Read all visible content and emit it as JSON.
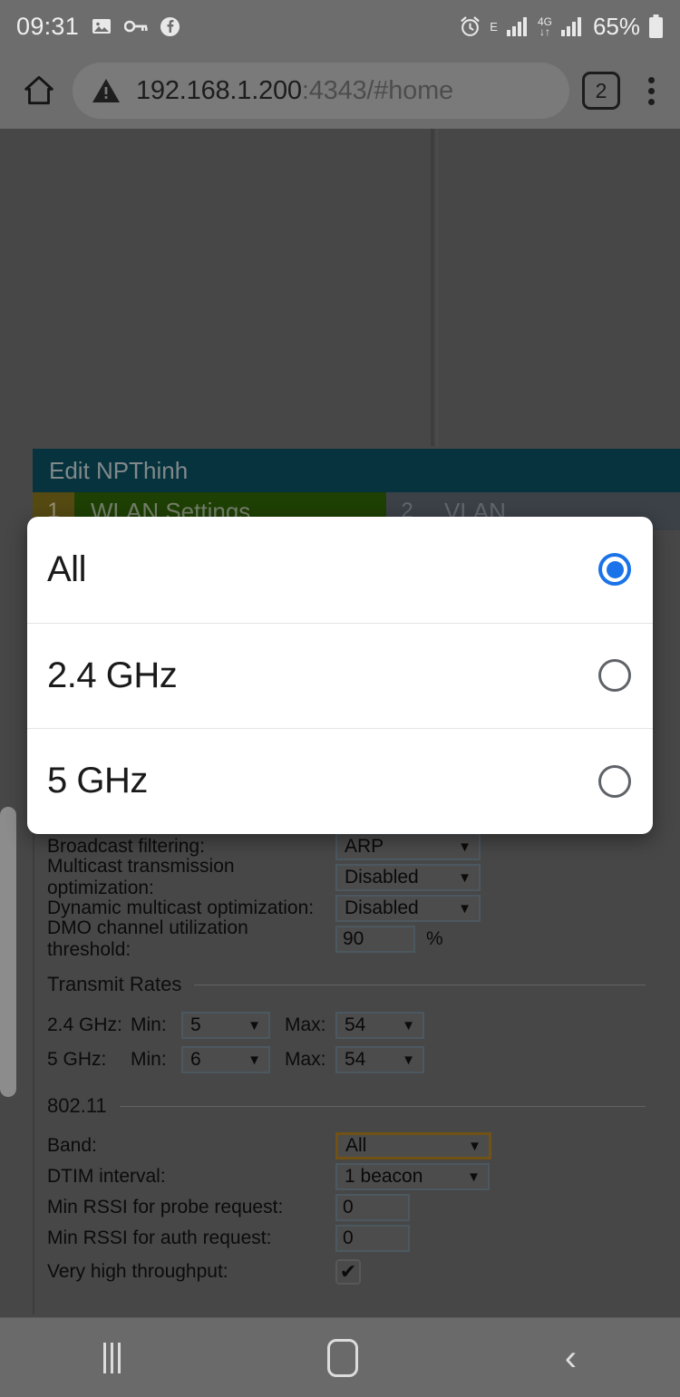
{
  "status_bar": {
    "clock": "09:31",
    "left_icons": [
      "image-icon",
      "vpn-key-icon",
      "facebook-icon"
    ],
    "alarm_icon": "alarm-icon",
    "network_type_letter": "E",
    "mobile_data_label": "4G",
    "data_arrows": "↓↑",
    "battery_percent": "65%",
    "battery_icon": "battery-icon"
  },
  "browser": {
    "home_icon": "home-icon",
    "security_icon": "insecure-warning-icon",
    "url_host": "192.168.1.200",
    "url_rest": ":4343/#home",
    "url_full": "192.168.1.200:4343/#home",
    "tab_count": "2",
    "menu_icon": "overflow-menu-icon"
  },
  "page": {
    "panel_title": "Edit NPThinh",
    "wizard": [
      {
        "num": "1",
        "label": "WLAN Settings",
        "active": true
      },
      {
        "num": "2",
        "label": "VLAN",
        "active": false
      }
    ],
    "fields": [
      {
        "label": "Broadcast filtering:",
        "value": "ARP",
        "type": "select",
        "width": 160
      },
      {
        "label": "Multicast transmission optimization:",
        "value": "Disabled",
        "type": "select",
        "width": 160
      },
      {
        "label": "Dynamic multicast optimization:",
        "value": "Disabled",
        "type": "select",
        "width": 160
      },
      {
        "label": "DMO channel utilization threshold:",
        "value": "90",
        "type": "text",
        "unit": "%",
        "width": 88
      }
    ],
    "transmit_rates": {
      "legend": "Transmit Rates",
      "min_label": "Min:",
      "max_label": "Max:",
      "rows": [
        {
          "band": "2.4 GHz:",
          "min": "5",
          "max": "54"
        },
        {
          "band": "5 GHz:",
          "min": "6",
          "max": "54"
        }
      ]
    },
    "dot11": {
      "legend": "802.11",
      "band_label": "Band:",
      "band_value": "All",
      "dtim_label": "DTIM interval:",
      "dtim_value": "1 beacon",
      "min_rssi_probe_label": "Min RSSI for probe request:",
      "min_rssi_probe_value": "0",
      "min_rssi_auth_label": "Min RSSI for auth request:",
      "min_rssi_auth_value": "0",
      "vht_label": "Very high throughput:",
      "vht_checked_glyph": "✔"
    },
    "caret_glyph": "▼"
  },
  "dialog": {
    "options": [
      {
        "label": "All",
        "selected": true
      },
      {
        "label": "2.4 GHz",
        "selected": false
      },
      {
        "label": "5 GHz",
        "selected": false
      }
    ],
    "accent_color": "#1a73e8"
  },
  "navbar": {
    "recents_label": "recents-button",
    "home_label": "home-button",
    "back_label": "back-button"
  }
}
